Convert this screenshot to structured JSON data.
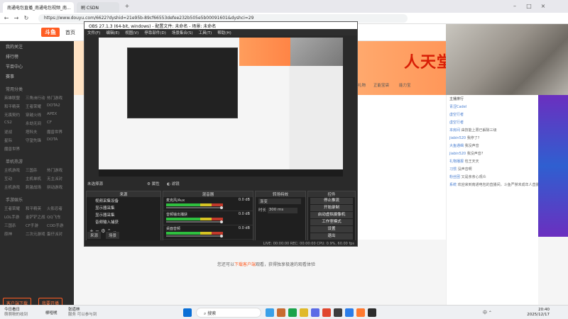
{
  "browser": {
    "tabs": [
      {
        "label": "南通电包直播_南通电包视频_南..."
      },
      {
        "label": "刷 CSDN"
      }
    ],
    "url": "https://www.douyu.com/6622?dyshid=21e95b-89cf66553defee232b505e5b00091601&dyshci=29"
  },
  "site": {
    "logo": "斗鱼",
    "home": "首页",
    "sidebar": {
      "items": [
        "我的关注",
        "排行榜",
        "节目中心",
        "赛事"
      ],
      "category_head": "常用分类",
      "grid1": [
        "英雄联盟",
        "三角洲行动",
        "热门游戏",
        "和平精英",
        "王者荣耀",
        "DOTA2",
        "无畏契约",
        "穿越火线",
        "APEX",
        "CS2",
        "永劫无间",
        "CF",
        "逆战",
        "塔科夫",
        "魔兽世界",
        "星际",
        "守望先锋",
        "DOTA",
        "魔兽世界"
      ],
      "section2": "单机热游",
      "grid2": [
        "主机游戏",
        "三国杀",
        "热门游戏",
        "互动",
        "主机单机",
        "无主派对",
        "主机游戏",
        "刺激战场",
        "拼动游戏"
      ],
      "section3": "手游娱乐",
      "grid3": [
        "王者荣耀",
        "和平精英",
        "火影忍者",
        "LOL手游",
        "金铲铲之战",
        "QQ飞车",
        "三国杀",
        "CF手游",
        "COD手游",
        "原神",
        "二次元游戏",
        "蛋仔派对"
      ],
      "cta_left": "客户端下载",
      "cta_right": "我要开播"
    },
    "banner_text": "人天堂 全民",
    "strip": [
      "礼物",
      "正能宝袋",
      "能力宝"
    ],
    "bottom_tip_prefix": "您还可以",
    "bottom_tip_link": "下载客户端",
    "bottom_tip_suffix": "观看，获得独享极速的观看体验",
    "chat": {
      "rank_title": "主播排行",
      "rows": [
        {
          "user": "青涩Cadel",
          "text": ""
        },
        {
          "user": "虚空行者",
          "text": ""
        },
        {
          "user": "虚空行者",
          "text": ""
        },
        {
          "user": "本房间",
          "text": "由技能上限已解除三级"
        },
        {
          "user": "jiabin520",
          "text": "我停了?"
        },
        {
          "user": "大鱼通缉",
          "text": "我没声音"
        },
        {
          "user": "jiabin520",
          "text": "我没声音?"
        },
        {
          "user": "礼物播报",
          "text": "包王天天"
        },
        {
          "user": "习惯",
          "text": "没声音啊"
        },
        {
          "user": "粉丝团",
          "text": "又是亲亲心观众"
        },
        {
          "user": "系统",
          "text": "欢迎来到南通电包的直播间，斗鱼严禁未成年人直播或打赏"
        }
      ]
    }
  },
  "obs": {
    "title": "OBS 27.1.3 (64-bit, windows) - 配置文件: 未命名 - 场景: 未命名",
    "menu": [
      "文件(F)",
      "编辑(E)",
      "视图(V)",
      "停靠部件(D)",
      "场景集合(S)",
      "工具(T)",
      "帮助(H)"
    ],
    "scene_label": "未选择源",
    "tool_props": "属性",
    "tool_filters": "滤镜",
    "panels": {
      "scenes": "来源",
      "mixer": "混音器",
      "transitions": "转场特效",
      "controls": "控件"
    },
    "sources": [
      "视频采集设备",
      "显示器采集",
      "显示器采集",
      "音频输入捕获"
    ],
    "mixer": [
      {
        "name": "麦克风/Aux",
        "db": "0.0 dB"
      },
      {
        "name": "音频输出捕获",
        "db": "0.0 dB"
      },
      {
        "name": "桌面音频",
        "db": "0.0 dB"
      }
    ],
    "transition": {
      "type": "渐变",
      "duration_label": "时长",
      "duration": "300 ms"
    },
    "controls": [
      "停止推流",
      "开始录制",
      "启动虚拟摄像机",
      "工作室模式",
      "设置",
      "退出"
    ],
    "bottom_tabs": [
      "来源",
      "场景"
    ],
    "status": "LIVE: 00:00:00    REC: 00:00:00    CPU: 0.9%, 60.00 fps"
  },
  "taskbar": {
    "weather_title": "今日看日",
    "weather_sub": "萌萌物的收到",
    "weather_tag": "柳噎唬",
    "app_label": "张道林",
    "app_sub": "服务 可以参与到",
    "search_placeholder": "搜索",
    "time": "20:40",
    "date": "2025/12/17",
    "tray": "中  ⌃"
  }
}
